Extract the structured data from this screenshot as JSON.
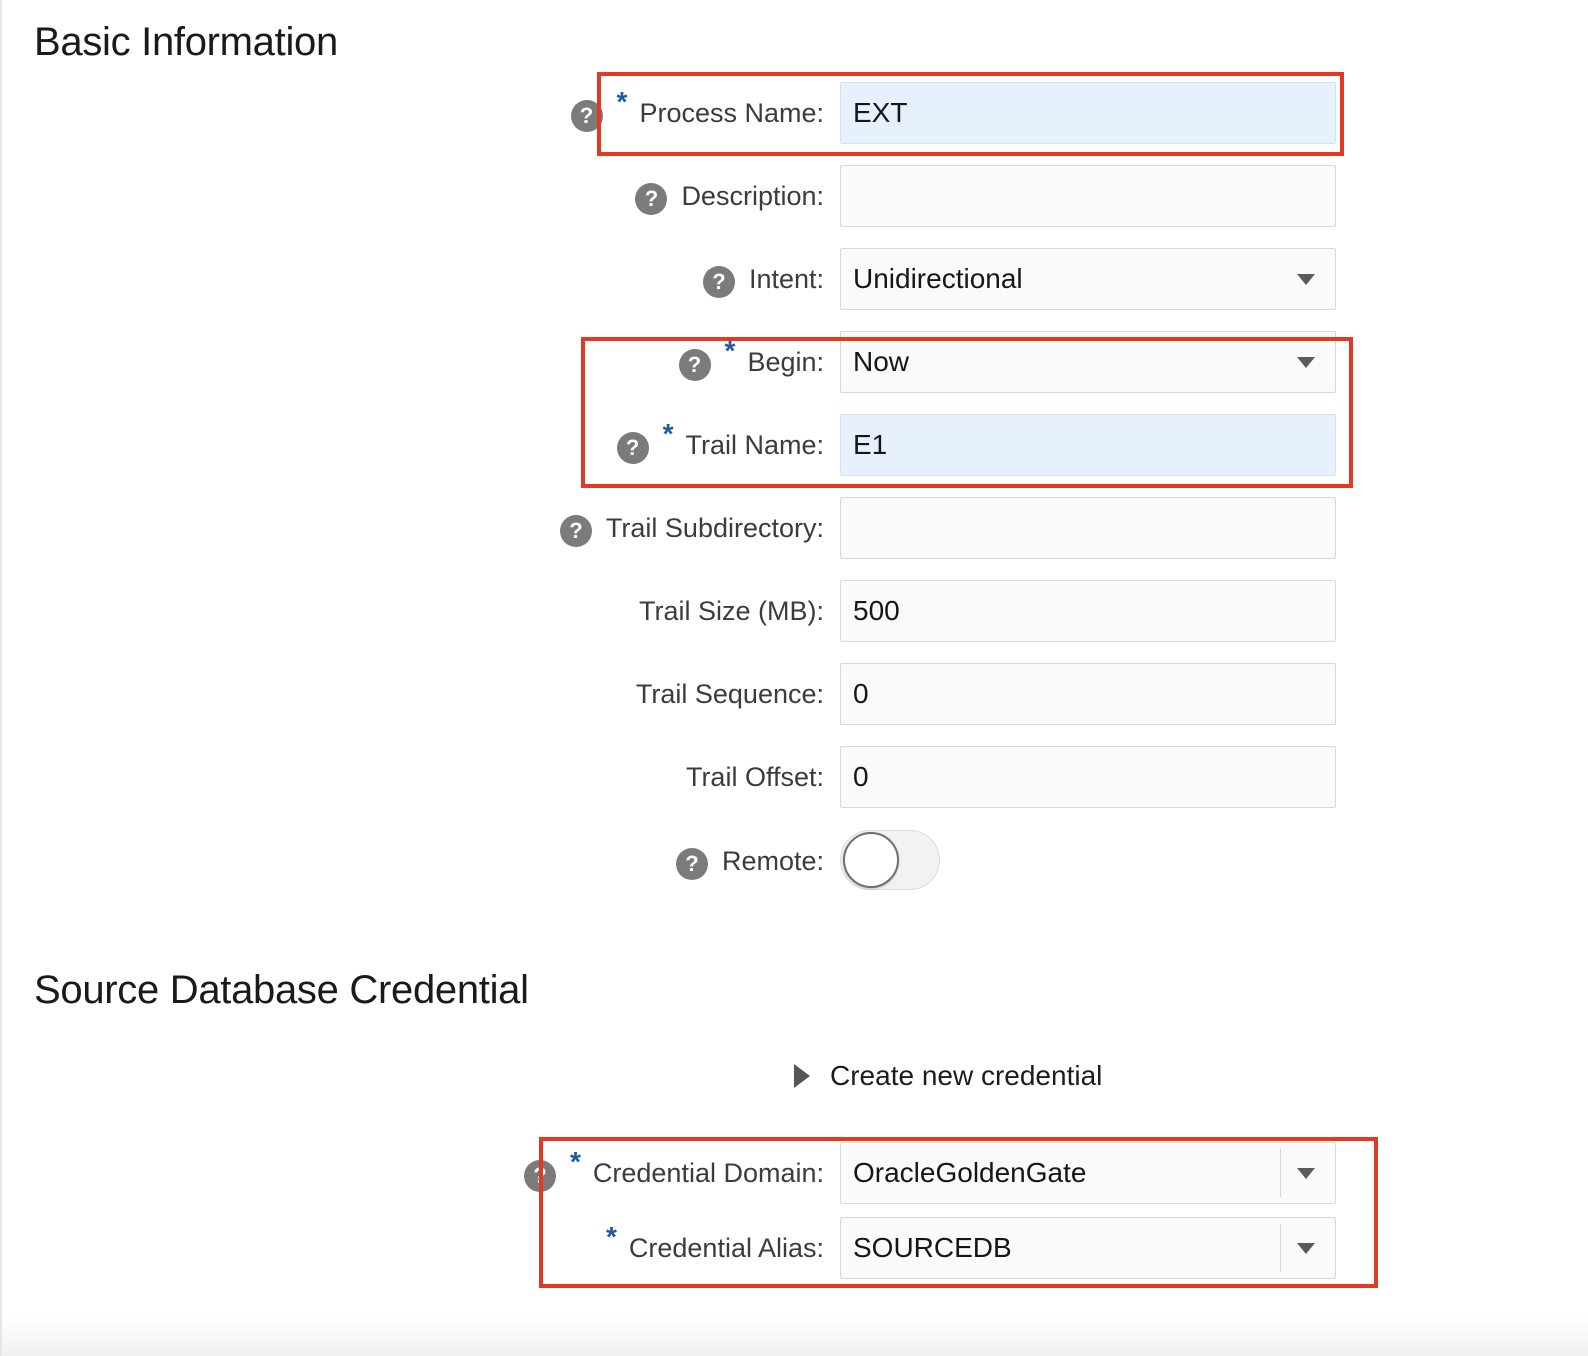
{
  "basic_info": {
    "title": "Basic Information",
    "process_name": {
      "label": "Process Name:",
      "value": "EXT"
    },
    "description": {
      "label": "Description:",
      "value": ""
    },
    "intent": {
      "label": "Intent:",
      "value": "Unidirectional"
    },
    "begin": {
      "label": "Begin:",
      "value": "Now"
    },
    "trail_name": {
      "label": "Trail Name:",
      "value": "E1"
    },
    "trail_subdirectory": {
      "label": "Trail Subdirectory:",
      "value": ""
    },
    "trail_size": {
      "label": "Trail Size (MB):",
      "value": "500"
    },
    "trail_sequence": {
      "label": "Trail Sequence:",
      "value": "0"
    },
    "trail_offset": {
      "label": "Trail Offset:",
      "value": "0"
    },
    "remote": {
      "label": "Remote:",
      "enabled": false
    }
  },
  "source_credential": {
    "title": "Source Database Credential",
    "create_new_label": "Create new credential",
    "credential_domain": {
      "label": "Credential Domain:",
      "value": "OracleGoldenGate"
    },
    "credential_alias": {
      "label": "Credential Alias:",
      "value": "SOURCEDB"
    }
  },
  "common": {
    "help_glyph": "?",
    "required_glyph": "*"
  },
  "colors": {
    "highlight": "#e03a24",
    "required": "#1e5aa0",
    "filled_field": "#e7f0fd",
    "help_icon": "#7b7b7b"
  }
}
